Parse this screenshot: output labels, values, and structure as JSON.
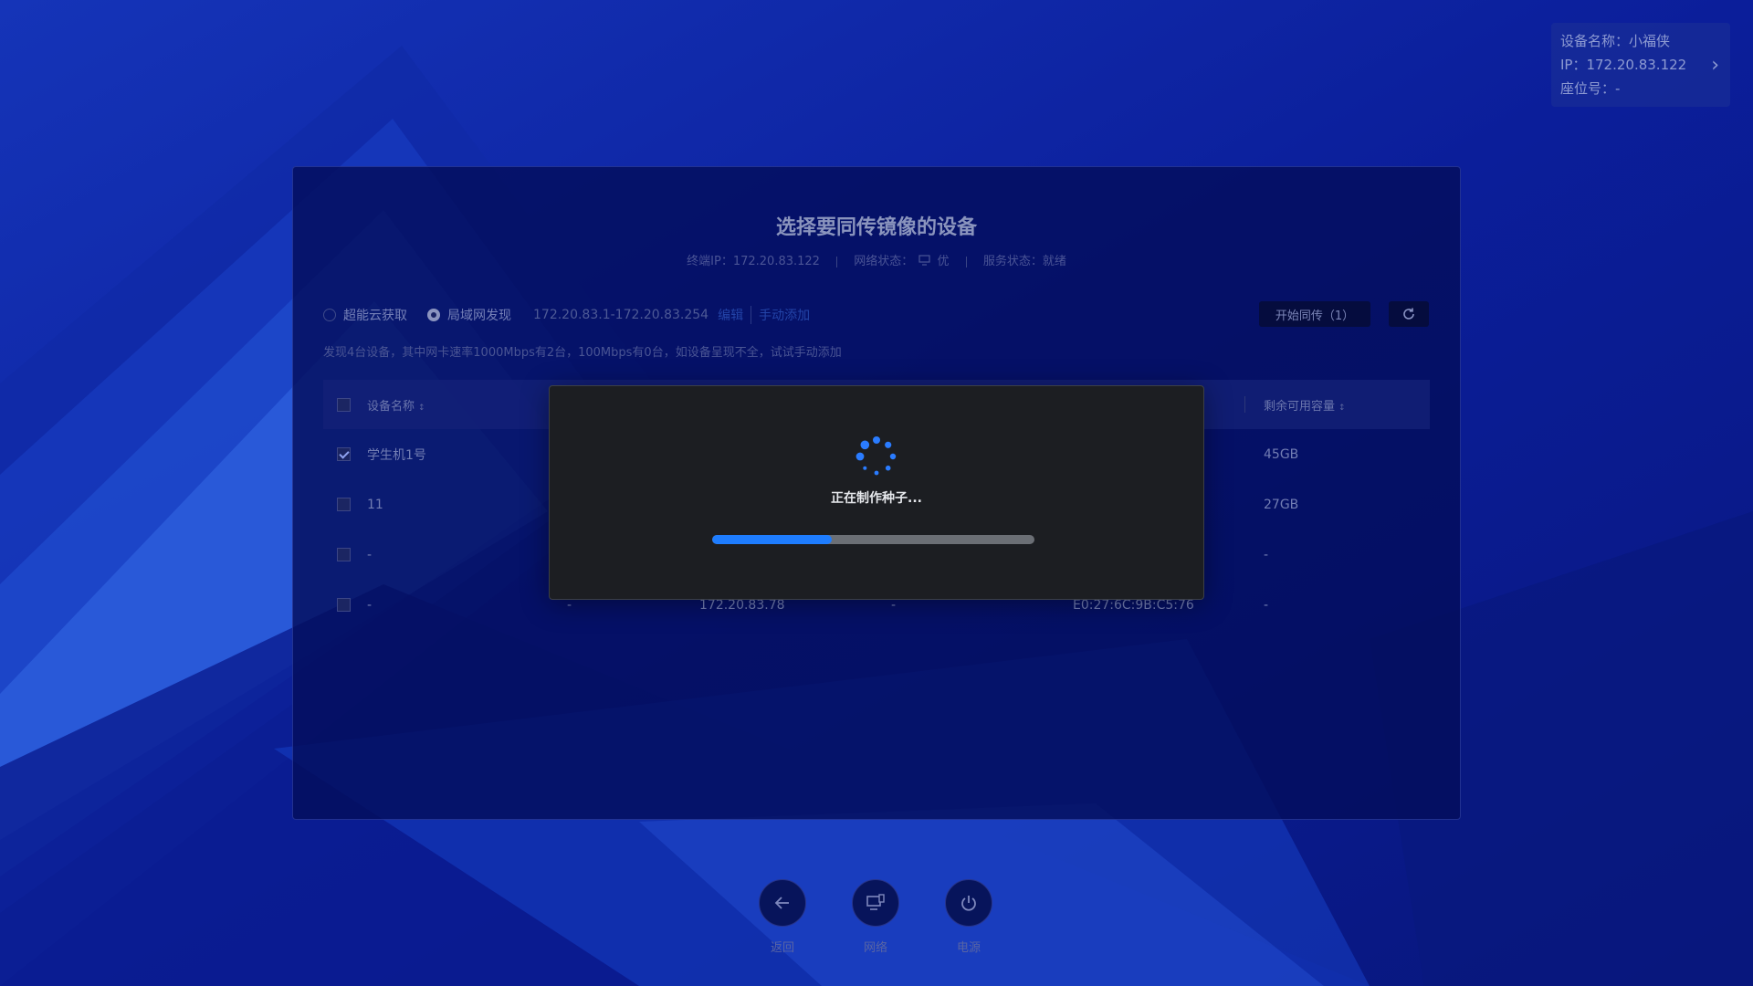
{
  "device_card": {
    "name_line": "设备名称：小福侠",
    "ip_line": "IP：172.20.83.122",
    "seat_line": "座位号：-"
  },
  "panel": {
    "title": "选择要同传镜像的设备",
    "terminal_ip": "终端IP：172.20.83.122",
    "network_status_label": "网络状态：",
    "network_status_value": "优",
    "service_status": "服务状态：就绪",
    "source_cloud": "超能云获取",
    "source_lan": "局域网发现",
    "ip_range": "172.20.83.1-172.20.83.254",
    "edit_link": "编辑",
    "manual_add_link": "手动添加",
    "start_sync_button": "开始同传（1）",
    "notice": "发现4台设备，其中网卡速率1000Mbps有2台，100Mbps有0台，如设备呈现不全，试试手动添加"
  },
  "table": {
    "headers": {
      "name": "设备名称",
      "capacity": "剩余可用容量"
    },
    "rows": [
      {
        "checked": true,
        "name": "学生机1号",
        "col2": "",
        "ip": "",
        "col4": "",
        "mac": "",
        "capacity": "45GB"
      },
      {
        "checked": false,
        "name": "11",
        "col2": "",
        "ip": "",
        "col4": "",
        "mac": "",
        "capacity": "27GB"
      },
      {
        "checked": false,
        "name": "-",
        "col2": "",
        "ip": "",
        "col4": "",
        "mac": "",
        "capacity": "-"
      },
      {
        "checked": false,
        "name": "-",
        "col2": "-",
        "ip": "172.20.83.78",
        "col4": "-",
        "mac": "E0:27:6C:9B:C5:76",
        "capacity": "-"
      }
    ]
  },
  "modal": {
    "message": "正在制作种子...",
    "progress": 0.37
  },
  "dock": {
    "back": "返回",
    "network": "网络",
    "power": "电源"
  },
  "colors": {
    "accent": "#1e7dff",
    "background": "#0b1a8c"
  }
}
